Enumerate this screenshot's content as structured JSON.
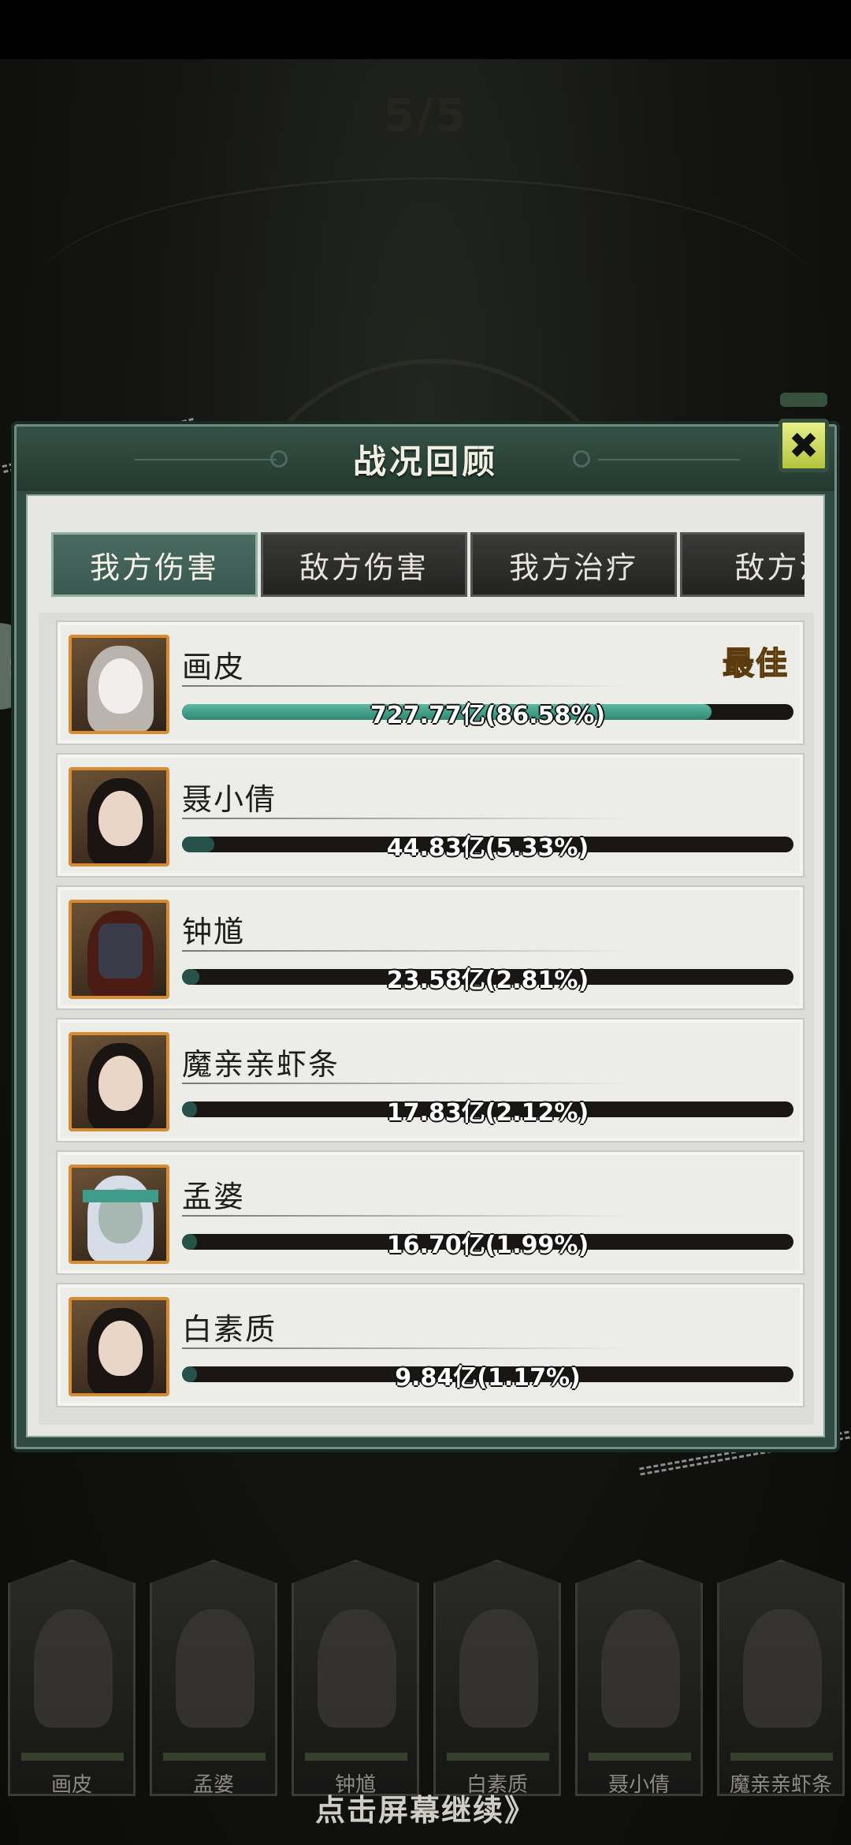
{
  "background": {
    "round_indicator": "5/5"
  },
  "side_tab": {
    "glyph": "»"
  },
  "panel": {
    "title": "战况回顾",
    "close_glyph": "✖"
  },
  "tabs": [
    {
      "label": "我方伤害",
      "active": true
    },
    {
      "label": "敌方伤害",
      "active": false
    },
    {
      "label": "我方治疗",
      "active": false
    },
    {
      "label": "敌方治",
      "active": false
    }
  ],
  "best_badge": "最佳",
  "rows": [
    {
      "name": "画皮",
      "value_text": "727.77亿(86.58%)",
      "share": 0.8658
    },
    {
      "name": "聂小倩",
      "value_text": "44.83亿(5.33%)",
      "share": 0.0533
    },
    {
      "name": "钟馗",
      "value_text": "23.58亿(2.81%)",
      "share": 0.0281
    },
    {
      "name": "魔亲亲虾条",
      "value_text": "17.83亿(2.12%)",
      "share": 0.0212
    },
    {
      "name": "孟婆",
      "value_text": "16.70亿(1.99%)",
      "share": 0.0199
    },
    {
      "name": "白素质",
      "value_text": "9.84亿(1.17%)",
      "share": 0.0117
    }
  ],
  "bottom_cards": [
    "画皮",
    "孟婆",
    "钟馗",
    "白素质",
    "聂小倩",
    "魔亲亲虾条"
  ],
  "continue_hint": "点击屏幕继续》"
}
